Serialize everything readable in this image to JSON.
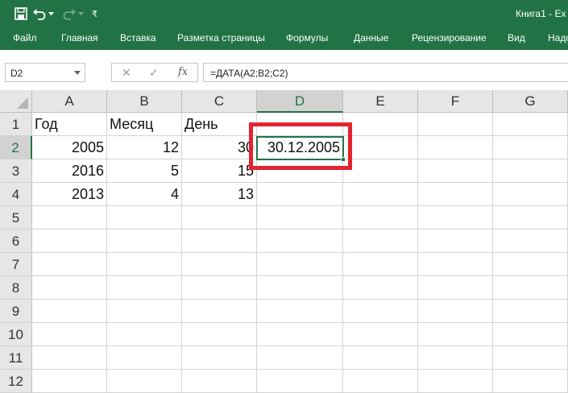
{
  "window": {
    "title": "Книга1 - Ex",
    "accent_color": "#217346"
  },
  "quick_access": {
    "icons": [
      "save-icon",
      "undo-icon",
      "undo-dropdown-icon",
      "redo-icon",
      "redo-dropdown-icon",
      "customize-qat-icon"
    ],
    "customize_glyph": "₹"
  },
  "ribbon": {
    "tabs": [
      "Файл",
      "Главная",
      "Вставка",
      "Разметка страницы",
      "Формулы",
      "Данные",
      "Рецензирование",
      "Вид",
      "Надс"
    ]
  },
  "formula_bar": {
    "name_box": "D2",
    "cancel_glyph": "✕",
    "enter_glyph": "✓",
    "fx_glyph": "fx",
    "formula": "=ДАТА(A2;B2;C2)"
  },
  "sheet": {
    "columns": [
      "A",
      "B",
      "C",
      "D",
      "E",
      "F",
      "G"
    ],
    "rows": [
      "1",
      "2",
      "3",
      "4",
      "5",
      "6",
      "7",
      "8",
      "9",
      "10",
      "11",
      "12"
    ],
    "active_cell": "D2",
    "highlight_color": "#e3232f",
    "cells": {
      "A1": "Год",
      "B1": "Месяц",
      "C1": "День",
      "A2": "2005",
      "B2": "12",
      "C2": "30",
      "D2": "30.12.2005",
      "A3": "2016",
      "B3": "5",
      "C3": "15",
      "A4": "2013",
      "B4": "4",
      "C4": "13"
    }
  }
}
